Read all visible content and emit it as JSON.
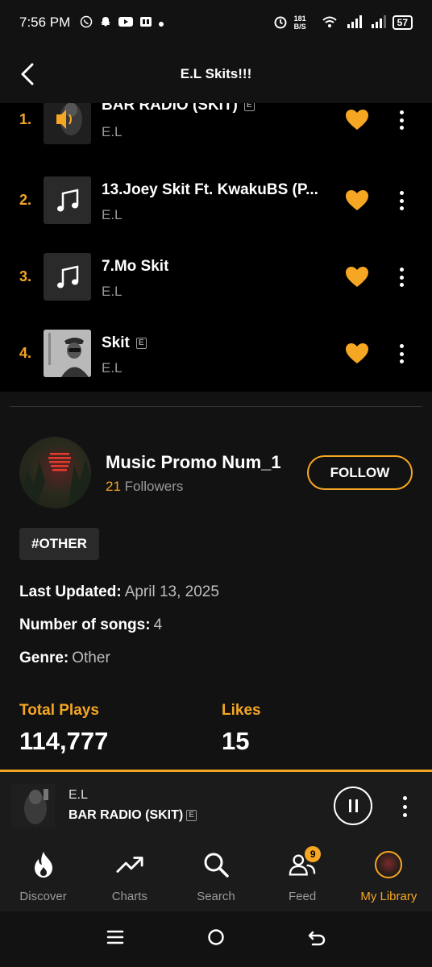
{
  "status": {
    "time": "7:56 PM",
    "net_speed": "181 B/S",
    "battery": "57"
  },
  "header": {
    "title": "E.L Skits!!!"
  },
  "tracks": [
    {
      "num": "1.",
      "title": "BAR RADIO (SKIT)",
      "artist": "E.L",
      "explicit": "E"
    },
    {
      "num": "2.",
      "title": "13.Joey Skit Ft. KwakuBS (P...",
      "artist": "E.L"
    },
    {
      "num": "3.",
      "title": "7.Mo Skit",
      "artist": "E.L"
    },
    {
      "num": "4.",
      "title": "Skit",
      "artist": "E.L",
      "explicit": "E"
    }
  ],
  "curator": {
    "name": "Music Promo Num_1",
    "followers_count": "21",
    "followers_label": "Followers",
    "follow_label": "FOLLOW"
  },
  "tag": "#OTHER",
  "meta": {
    "last_updated_label": "Last Updated:",
    "last_updated": "April 13, 2025",
    "songs_label": "Number of songs:",
    "songs": "4",
    "genre_label": "Genre:",
    "genre": "Other"
  },
  "stats": {
    "plays_label": "Total Plays",
    "plays": "114,777",
    "likes_label": "Likes",
    "likes": "15"
  },
  "player": {
    "artist": "E.L",
    "title": "BAR RADIO (SKIT)",
    "explicit": "E"
  },
  "nav": {
    "discover": "Discover",
    "charts": "Charts",
    "search": "Search",
    "feed": "Feed",
    "feed_badge": "9",
    "library": "My Library"
  },
  "colors": {
    "accent": "#f5a623",
    "background": "#121212",
    "list_background": "#000000"
  }
}
